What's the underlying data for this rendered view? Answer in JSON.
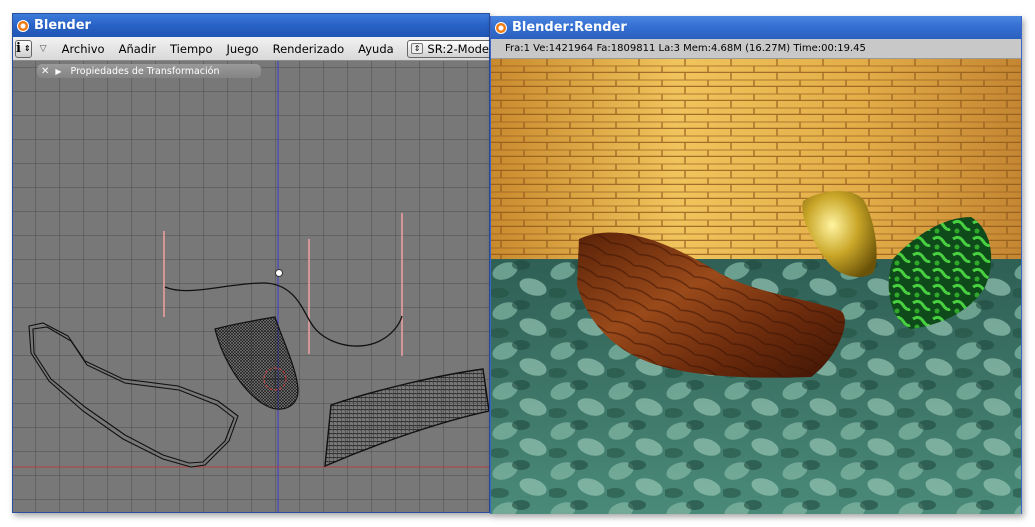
{
  "main_window": {
    "title": "Blender",
    "menu": {
      "info_icon": "info-i-icon",
      "items": [
        "Archivo",
        "Añadir",
        "Tiempo",
        "Juego",
        "Renderizado",
        "Ayuda"
      ],
      "scene_selector": "SR:2-Mode"
    },
    "panel": {
      "close_glyph": "✕",
      "expand_glyph": "▶",
      "label": "Propiedades de Transformación"
    }
  },
  "render_window": {
    "title": "Blender:Render",
    "info": "Fra:1  Ve:1421964 Fa:1809811 La:3 Mem:4.68M (16.27M) Time:00:19.45"
  },
  "colors": {
    "titlebar_blue": "#2a64c8",
    "viewport_gray": "#787878",
    "axis_blue": "#3a3ad0",
    "axis_red": "#b04040",
    "wall_orange": "#d99a3a",
    "floor_green": "#3f7a68"
  }
}
